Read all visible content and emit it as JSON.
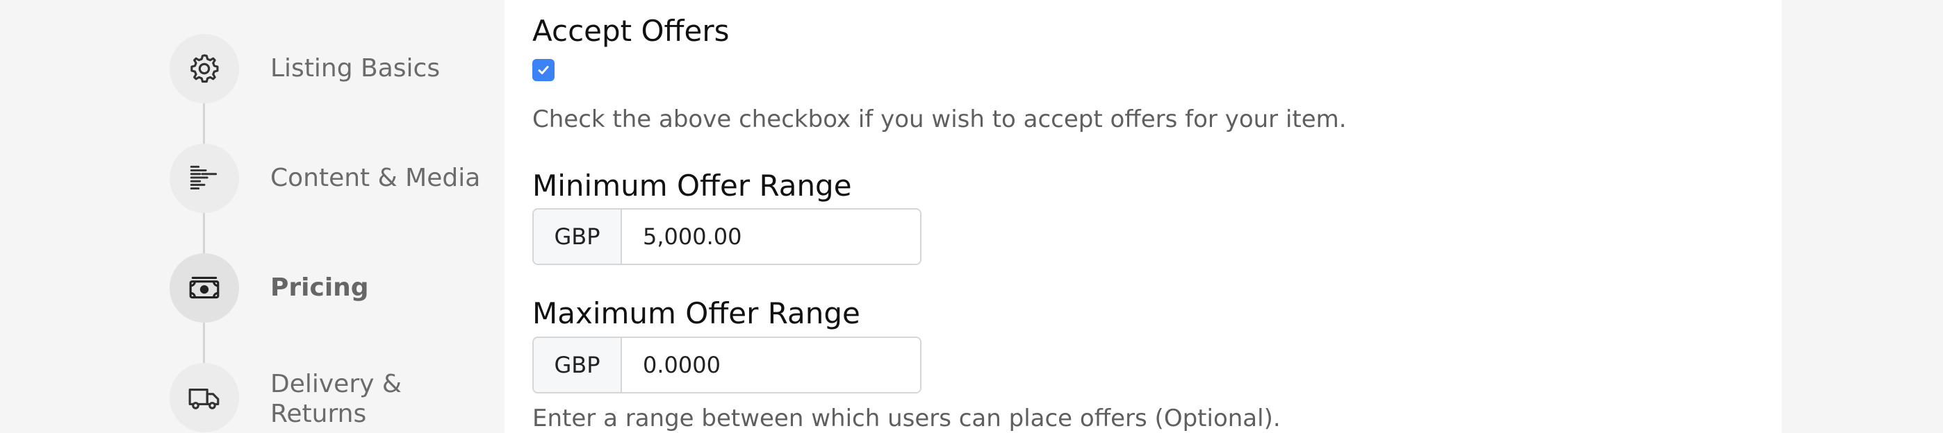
{
  "sidebar": {
    "steps": [
      {
        "label": "Listing Basics",
        "icon": "gear-icon",
        "active": false
      },
      {
        "label": "Content & Media",
        "icon": "text-align-icon",
        "active": false
      },
      {
        "label": "Pricing",
        "icon": "banknote-icon",
        "active": true
      },
      {
        "label_line1": "Delivery &",
        "label_line2": "Returns",
        "icon": "truck-icon",
        "active": false
      }
    ]
  },
  "main": {
    "accept_offers": {
      "title": "Accept Offers",
      "checked": true,
      "help": "Check the above checkbox if you wish to accept offers for your item."
    },
    "min_offer": {
      "title": "Minimum Offer Range",
      "currency": "GBP",
      "value": "5,000.00"
    },
    "max_offer": {
      "title": "Maximum Offer Range",
      "currency": "GBP",
      "value": "0.0000"
    },
    "range_help": "Enter a range between which users can place offers (Optional)."
  },
  "colors": {
    "accent": "#3b82f6",
    "panel_bg": "#ffffff",
    "page_bg": "#f5f5f5"
  }
}
